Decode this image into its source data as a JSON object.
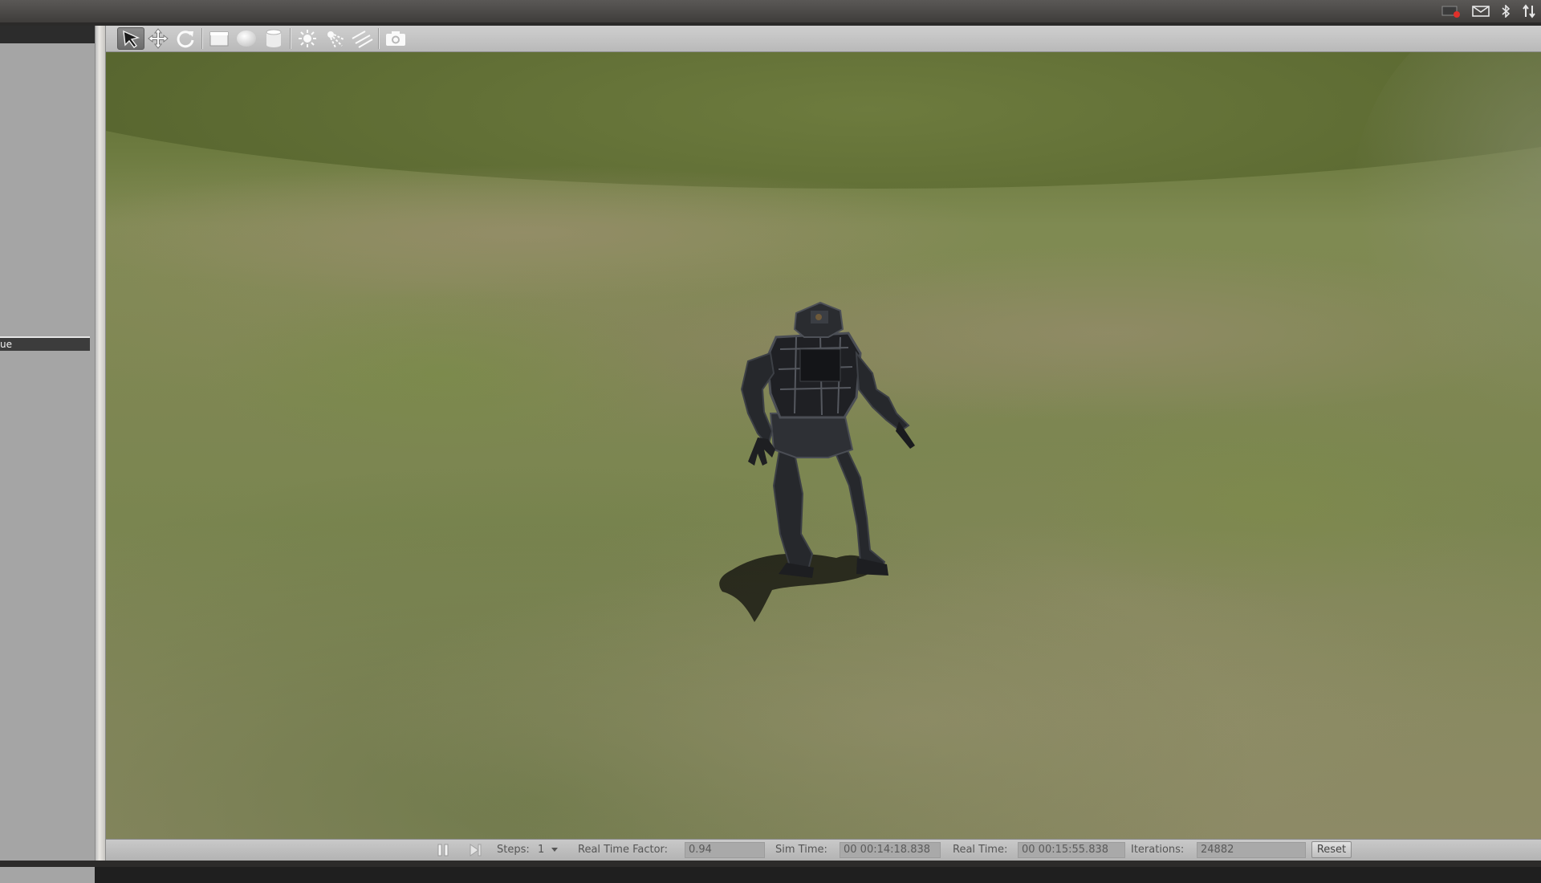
{
  "left_panel": {
    "selected_row_text": "ue"
  },
  "toolbar": {
    "tools": [
      {
        "name": "select-mode",
        "icon": "arrow-cursor-icon",
        "active": true
      },
      {
        "name": "translate-mode",
        "icon": "move-arrows-icon"
      },
      {
        "name": "rotate-mode",
        "icon": "rotate-icon"
      },
      {
        "name": "box-shape",
        "icon": "box-icon"
      },
      {
        "name": "sphere-shape",
        "icon": "sphere-icon"
      },
      {
        "name": "cylinder-shape",
        "icon": "cylinder-icon"
      },
      {
        "name": "point-light",
        "icon": "sun-icon"
      },
      {
        "name": "spot-light",
        "icon": "spotlight-icon"
      },
      {
        "name": "directional-light",
        "icon": "directional-light-icon"
      },
      {
        "name": "screenshot",
        "icon": "camera-icon"
      }
    ]
  },
  "status": {
    "steps_label": "Steps:",
    "steps_value": "1",
    "rtf_label": "Real Time Factor:",
    "rtf_value": "0.94",
    "sim_time_label": "Sim Time:",
    "sim_time_value": "00 00:14:18.838",
    "real_time_label": "Real Time:",
    "real_time_value": "00 00:15:55.838",
    "iterations_label": "Iterations:",
    "iterations_value": "24882",
    "reset_label": "Reset"
  },
  "tray_icons": [
    "recording-icon",
    "mail-icon",
    "bluetooth-icon",
    "network-icon"
  ]
}
